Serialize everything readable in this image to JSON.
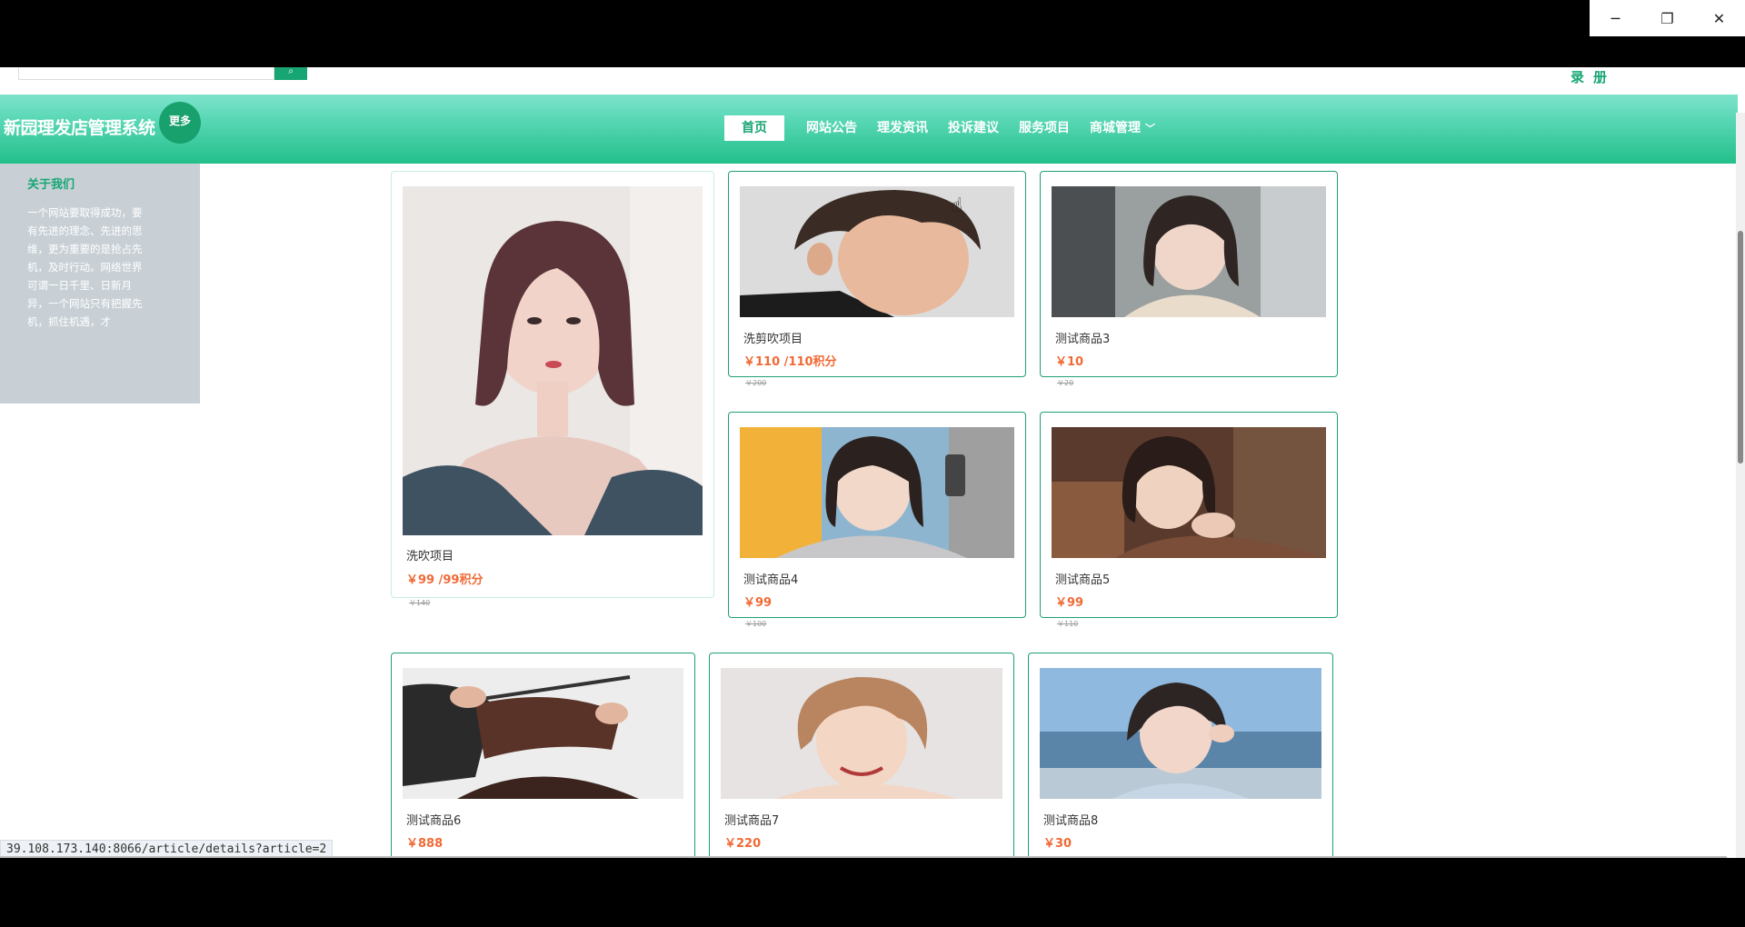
{
  "window": {
    "controls": {
      "minimize": "─",
      "restore": "❐",
      "close": "✕"
    }
  },
  "search": {
    "button_icon": "search-icon"
  },
  "auth": {
    "login": "录",
    "register": "册"
  },
  "navbar": {
    "brand": "新园理发店管理系统",
    "more": "更多",
    "items": [
      {
        "label": "首页",
        "active": true
      },
      {
        "label": "网站公告"
      },
      {
        "label": "理发资讯"
      },
      {
        "label": "投诉建议"
      },
      {
        "label": "服务项目"
      },
      {
        "label": "商城管理",
        "has_dropdown": true
      }
    ]
  },
  "about": {
    "title": "关于我们",
    "body": "一个网站要取得成功，要有先进的理念、先进的思维，更为重要的是抢占先机，及时行动。网络世界可谓一日千里、日新月异，一个网站只有把握先机，抓住机遇，才"
  },
  "products": [
    {
      "name": "洗吹项目",
      "price": "￥99 /99积分",
      "old": "￥140"
    },
    {
      "name": "洗剪吹项目",
      "price": "￥110 /110积分",
      "old": "￥200"
    },
    {
      "name": "测试商品3",
      "price": "￥10",
      "old": "￥20"
    },
    {
      "name": "测试商品4",
      "price": "￥99",
      "old": "￥100"
    },
    {
      "name": "测试商品5",
      "price": "￥99",
      "old": "￥110"
    },
    {
      "name": "测试商品6",
      "price": "￥888",
      "old": ""
    },
    {
      "name": "测试商品7",
      "price": "￥220",
      "old": ""
    },
    {
      "name": "测试商品8",
      "price": "￥30",
      "old": ""
    }
  ],
  "status_url": "39.108.173.140:8066/article/details?article=2",
  "colors": {
    "accent": "#17a673",
    "price": "#f06a36",
    "nav_gradient_top": "#7ee3cb",
    "nav_gradient_bottom": "#22bf8a"
  }
}
